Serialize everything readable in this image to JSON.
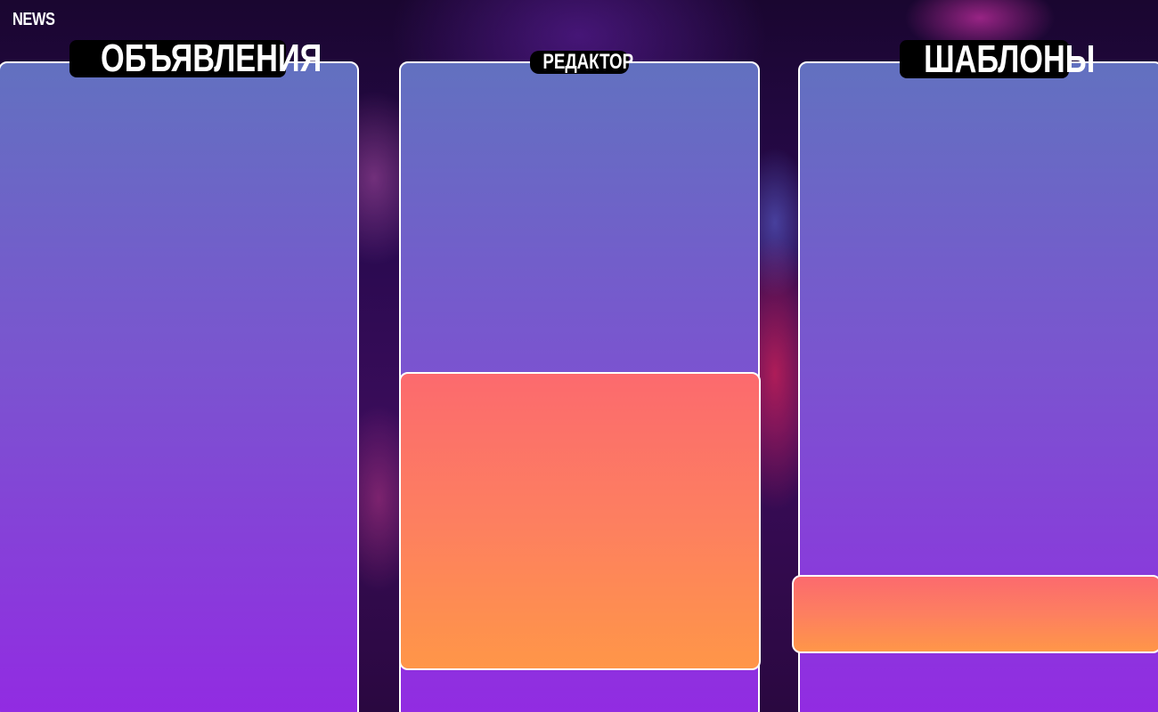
{
  "app": {
    "label": "NEWS"
  },
  "panels": {
    "left": {
      "title": "ОБЪЯВЛЕНИЯ"
    },
    "middle": {
      "title": "РЕДАКТОР"
    },
    "right": {
      "title": "ШАБЛОНЫ"
    }
  },
  "colors": {
    "panel_gradient_top": "#6271c0",
    "panel_gradient_bottom": "#922be2",
    "highlight_gradient_top": "#fc6a6e",
    "highlight_gradient_bottom": "#ff9648",
    "title_badge_bg": "#000000",
    "border": "#ffffff"
  }
}
